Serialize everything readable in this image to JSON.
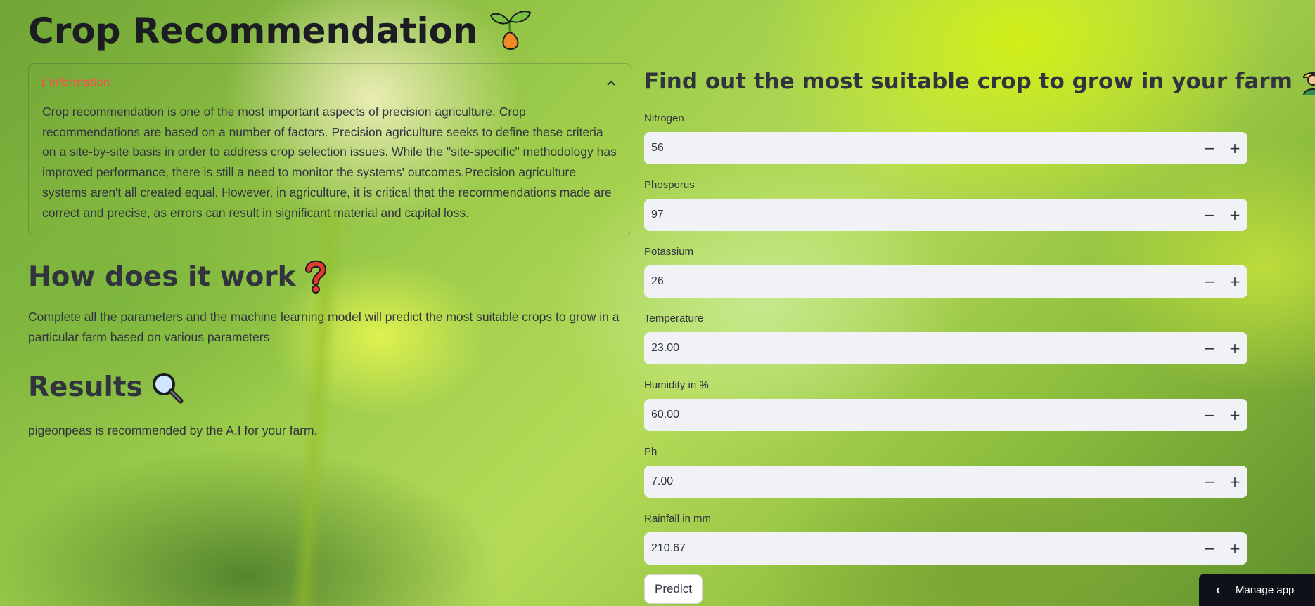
{
  "page": {
    "title": "Crop Recommendation",
    "title_icon": "seedling-icon"
  },
  "info": {
    "header": "ℹ Information",
    "body": "Crop recommendation is one of the most important aspects of precision agriculture. Crop recommendations are based on a number of factors. Precision agriculture seeks to define these criteria on a site-by-site basis in order to address crop selection issues. While the \"site-specific\" methodology has improved performance, there is still a need to monitor the systems' outcomes.Precision agriculture systems aren't all created equal. However, in agriculture, it is critical that the recommendations made are correct and precise, as errors can result in significant material and capital loss."
  },
  "how": {
    "heading": "How does it work",
    "heading_icon": "question-mark-icon",
    "text": "Complete all the parameters and the machine learning model will predict the most suitable crops to grow in a particular farm based on various parameters"
  },
  "results": {
    "heading": "Results",
    "heading_icon": "magnifier-icon",
    "text": "pigeonpeas is recommended by the A.I for your farm."
  },
  "form": {
    "heading": "Find out the most suitable crop to grow in your farm",
    "heading_icon": "farmer-icon",
    "fields": [
      {
        "label": "Nitrogen",
        "value": "56"
      },
      {
        "label": "Phosporus",
        "value": "97"
      },
      {
        "label": "Potassium",
        "value": "26"
      },
      {
        "label": "Temperature",
        "value": "23.00"
      },
      {
        "label": "Humidity in %",
        "value": "60.00"
      },
      {
        "label": "Ph",
        "value": "7.00"
      },
      {
        "label": "Rainfall in mm",
        "value": "210.67"
      }
    ],
    "minus": "−",
    "plus": "+",
    "predict_label": "Predict"
  },
  "manage": {
    "label": "Manage app",
    "chevron": "‹"
  },
  "colors": {
    "accent": "#ff4b4b",
    "text": "#31333f",
    "input_bg": "#f0f2f6",
    "manage_bg": "#0e1117"
  }
}
